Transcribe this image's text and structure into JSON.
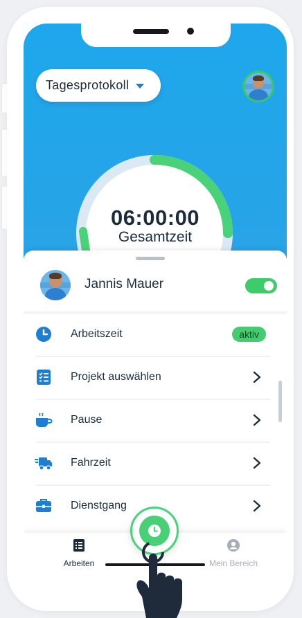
{
  "header": {
    "view_select": "Tagesprotokoll"
  },
  "timer": {
    "value": "06:00:00",
    "label": "Gesamtzeit",
    "progress_fraction": 0.25
  },
  "user": {
    "name": "Jannis Mauer",
    "active_toggle": true
  },
  "menu": {
    "items": [
      {
        "label": "Arbeitszeit",
        "icon": "clock-icon",
        "badge": "aktiv"
      },
      {
        "label": "Projekt auswählen",
        "icon": "checklist-icon"
      },
      {
        "label": "Pause",
        "icon": "coffee-icon"
      },
      {
        "label": "Fahrzeit",
        "icon": "truck-icon"
      },
      {
        "label": "Dienstgang",
        "icon": "briefcase-icon"
      }
    ]
  },
  "tabbar": {
    "left_label": "Arbeiten",
    "right_label": "Mein Bereich"
  },
  "colors": {
    "header_blue": "#1ea7ec",
    "accent_green": "#43cc70",
    "icon_blue": "#1e7fd2",
    "text_dark": "#1c2b3c"
  }
}
